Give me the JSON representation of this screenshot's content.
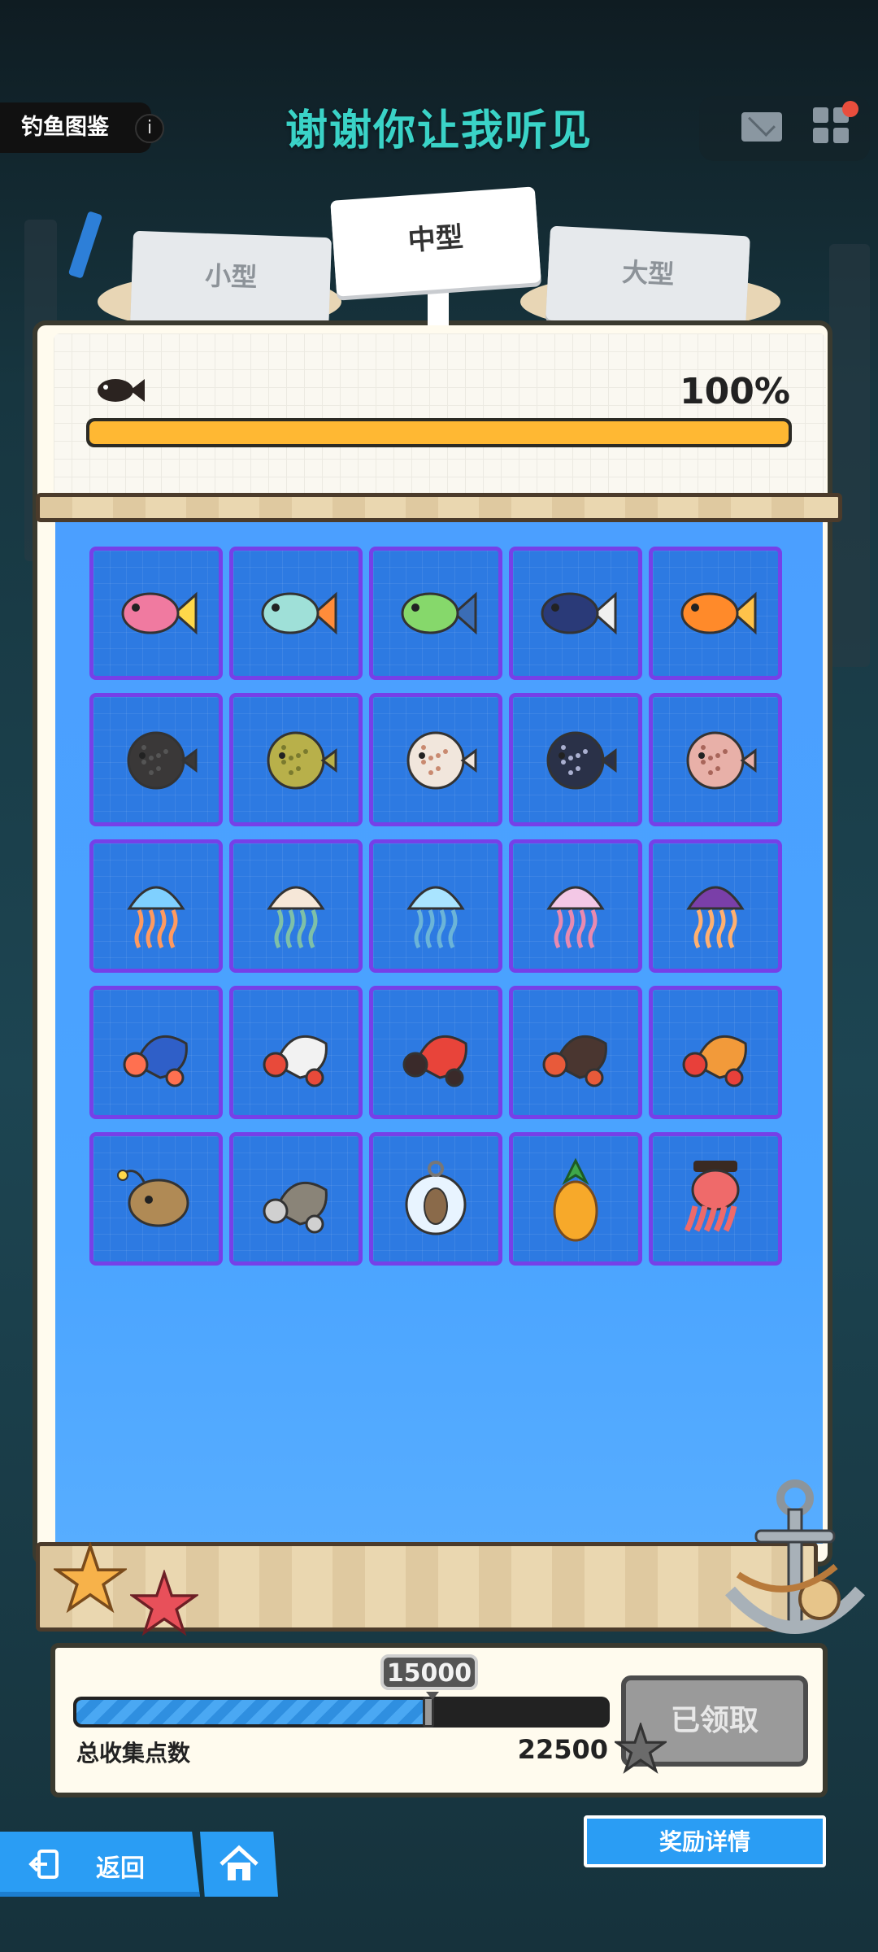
{
  "header": {
    "page_tag": "钓鱼图鉴",
    "info_icon": "info-icon",
    "song_title": "谢谢你让我听见",
    "icons": [
      "mail-icon",
      "grid-menu-icon"
    ]
  },
  "tabs": [
    {
      "label": "小型",
      "selected": false
    },
    {
      "label": "中型",
      "selected": true
    },
    {
      "label": "大型",
      "selected": false
    }
  ],
  "progress": {
    "icon": "fish-silhouette-icon",
    "percent_label": "100%",
    "value": 1.0,
    "colors": {
      "fill": "#ffb833",
      "track": "#2c2b25"
    }
  },
  "collection": {
    "items": [
      {
        "icon": "pink-yellow-tail-fish-icon"
      },
      {
        "icon": "teal-puffer-fish-icon"
      },
      {
        "icon": "green-fish-icon"
      },
      {
        "icon": "dark-blue-fish-icon"
      },
      {
        "icon": "orange-goldfish-icon"
      },
      {
        "icon": "spiky-black-pufferfish-icon"
      },
      {
        "icon": "yellow-spotted-pufferfish-icon"
      },
      {
        "icon": "white-spotted-pufferfish-icon"
      },
      {
        "icon": "navy-spotted-pufferfish-icon"
      },
      {
        "icon": "pink-pufferfish-icon"
      },
      {
        "icon": "blue-jellyfish-icon"
      },
      {
        "icon": "cream-jellyfish-icon"
      },
      {
        "icon": "light-blue-jellyfish-icon"
      },
      {
        "icon": "pink-jellyfish-icon"
      },
      {
        "icon": "purple-jellyfish-icon"
      },
      {
        "icon": "blue-hermit-crab-icon"
      },
      {
        "icon": "red-white-hermit-crab-icon"
      },
      {
        "icon": "red-hermit-crab-icon"
      },
      {
        "icon": "brown-hermit-crab-icon"
      },
      {
        "icon": "orange-hermit-crab-icon"
      },
      {
        "icon": "anglerfish-icon"
      },
      {
        "icon": "knife-crab-icon"
      },
      {
        "icon": "otter-in-bubble-icon"
      },
      {
        "icon": "pineapple-icon"
      },
      {
        "icon": "pirate-octopus-icon"
      }
    ]
  },
  "reward_progress": {
    "marker_label": "15000",
    "current": 15000,
    "max": 22500,
    "total_label": "总收集点数",
    "total_value": "22500",
    "claim_button": "已领取"
  },
  "footer": {
    "back_label": "返回",
    "home_icon": "home-icon",
    "reward_details": "奖励详情"
  },
  "colors": {
    "accent_blue": "#2a9df4",
    "cell_border": "#7640e8",
    "pool_blue": "#4aa4ff",
    "song_title": "#3ad3c7"
  }
}
